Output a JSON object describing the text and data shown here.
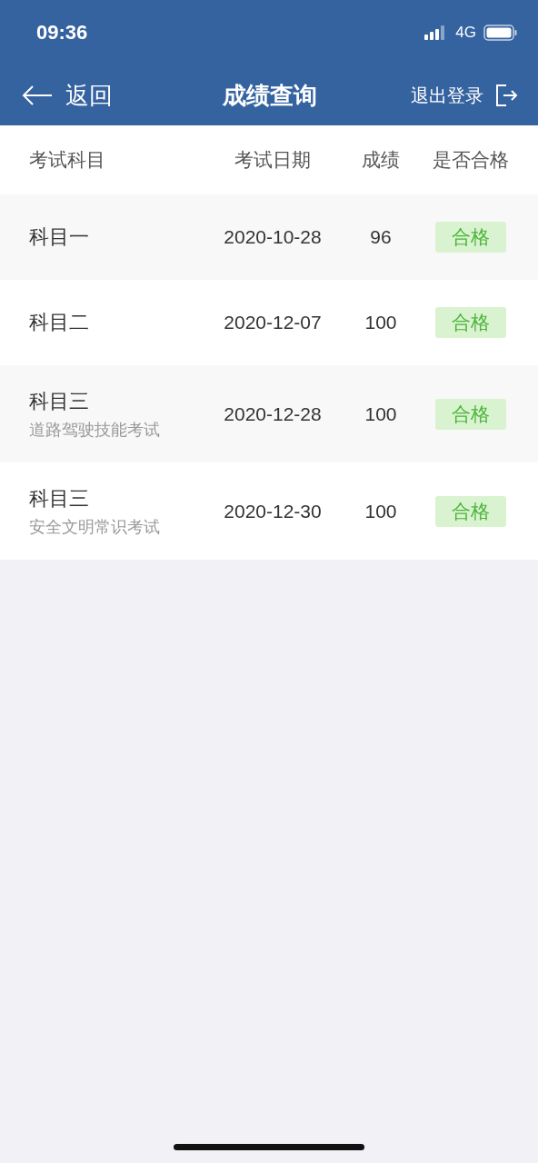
{
  "status_bar": {
    "time": "09:36",
    "network": "4G"
  },
  "nav": {
    "back": "返回",
    "title": "成绩查询",
    "logout": "退出登录"
  },
  "table": {
    "columns": [
      "考试科目",
      "考试日期",
      "成绩",
      "是否合格"
    ],
    "rows": [
      {
        "subject": "科目一",
        "date": "2020-10-28",
        "score": "96",
        "result": "合格",
        "passed": true
      },
      {
        "subject": "科目二",
        "date": "2020-12-07",
        "score": "100",
        "result": "合格",
        "passed": true
      },
      {
        "subject": "科目三",
        "detail": "道路驾驶技能考试",
        "date": "2020-12-28",
        "score": "100",
        "result": "合格",
        "passed": true
      },
      {
        "subject": "科目三",
        "detail": "安全文明常识考试",
        "date": "2020-12-30",
        "score": "100",
        "result": "合格",
        "passed": true
      }
    ]
  }
}
